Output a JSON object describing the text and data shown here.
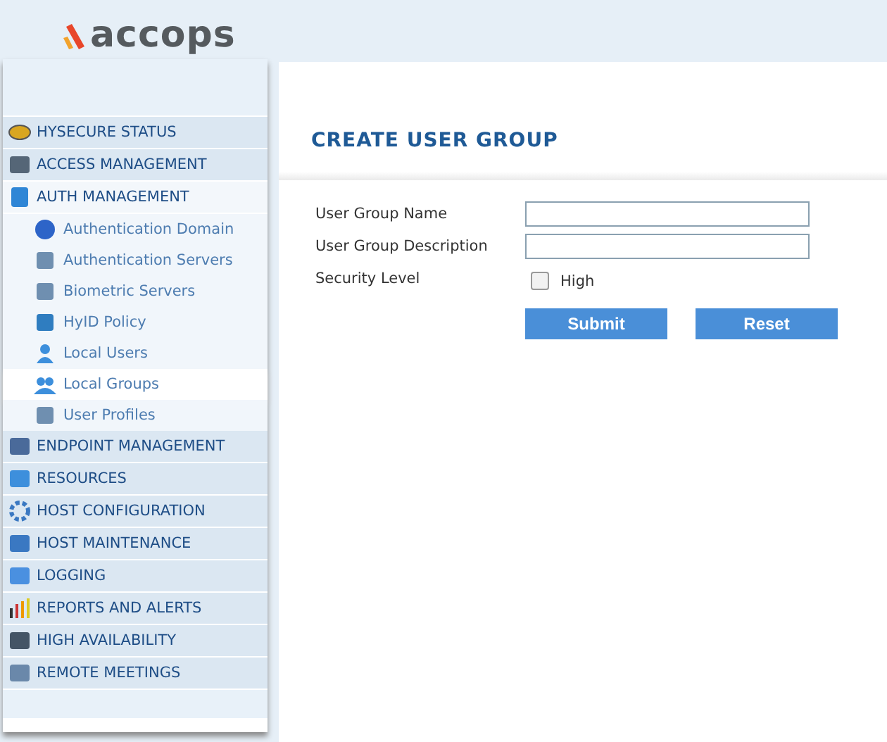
{
  "header": {
    "logo": "accops"
  },
  "menu": [
    {
      "label": "HYSECURE STATUS",
      "selected": false
    },
    {
      "label": "ACCESS MANAGEMENT",
      "selected": false
    },
    {
      "label": "AUTH MANAGEMENT",
      "selected": false,
      "expanded": true,
      "children": [
        {
          "label": "Authentication Domain",
          "selected": false
        },
        {
          "label": "Authentication Servers",
          "selected": false
        },
        {
          "label": "Biometric Servers",
          "selected": false
        },
        {
          "label": "HyID Policy",
          "selected": false
        },
        {
          "label": "Local Users",
          "selected": false
        },
        {
          "label": "Local Groups",
          "selected": true
        },
        {
          "label": "User Profiles",
          "selected": false
        }
      ]
    },
    {
      "label": "ENDPOINT MANAGEMENT",
      "selected": false
    },
    {
      "label": "RESOURCES",
      "selected": false
    },
    {
      "label": "HOST CONFIGURATION",
      "selected": false
    },
    {
      "label": "HOST MAINTENANCE",
      "selected": false
    },
    {
      "label": "LOGGING",
      "selected": false
    },
    {
      "label": "REPORTS AND ALERTS",
      "selected": false
    },
    {
      "label": "HIGH AVAILABILITY",
      "selected": false
    },
    {
      "label": "REMOTE MEETINGS",
      "selected": false
    }
  ],
  "page": {
    "title": "CREATE USER GROUP",
    "fields": [
      {
        "kind": "text",
        "label": "User Group Name"
      },
      {
        "kind": "text",
        "label": "User Group Description"
      },
      {
        "kind": "checkbox",
        "label": "Security Level",
        "option": "High",
        "checked": false
      }
    ],
    "buttons": [
      "Submit",
      "Reset"
    ]
  }
}
